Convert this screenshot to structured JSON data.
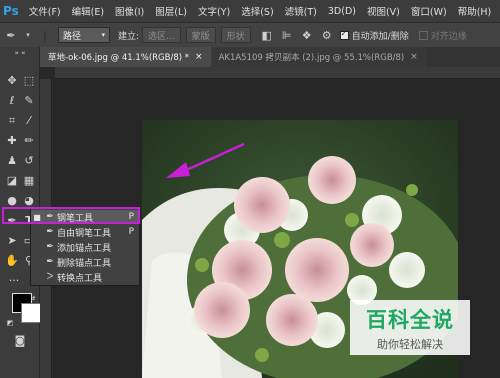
{
  "app": {
    "logo": "Ps"
  },
  "menu": [
    "文件(F)",
    "编辑(E)",
    "图像(I)",
    "图层(L)",
    "文字(Y)",
    "选择(S)",
    "滤镜(T)",
    "3D(D)",
    "视图(V)",
    "窗口(W)",
    "帮助(H)"
  ],
  "options": {
    "mode_select": "路径",
    "build_label": "建立:",
    "selection_button": "选区...",
    "mask_button": "蒙版",
    "shape_button": "形状",
    "auto_add_delete": "自动添加/删除",
    "align_edges": "对齐边缘"
  },
  "tabs": [
    {
      "label": "草地-ok-06.jpg @ 41.1%(RGB/8) *",
      "close": "×"
    },
    {
      "label": "AK1A5109 拷贝副本 (2).jpg @ 55.1%(RGB/8)",
      "close": "×"
    }
  ],
  "flyout": [
    {
      "label": "钢笔工具",
      "key": "P",
      "selected": true
    },
    {
      "label": "自由钢笔工具",
      "key": "P",
      "selected": false
    },
    {
      "label": "添加锚点工具",
      "key": "",
      "selected": false
    },
    {
      "label": "删除锚点工具",
      "key": "",
      "selected": false
    },
    {
      "label": "转换点工具",
      "key": "",
      "selected": false
    }
  ],
  "watermark": {
    "title": "百科全说",
    "subtitle": "助你轻松解决"
  },
  "colors": {
    "highlight": "#c81fd8",
    "arrow": "#c81fd8",
    "watermark_green": "#1ea861"
  }
}
